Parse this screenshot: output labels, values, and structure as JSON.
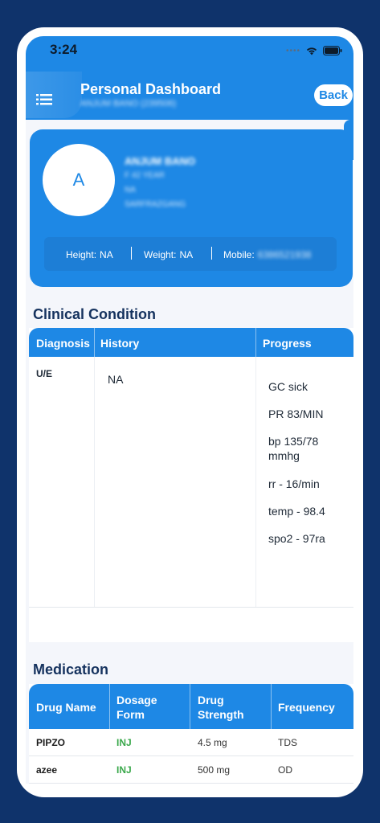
{
  "status": {
    "time": "3:24"
  },
  "header": {
    "title": "Personal Dashboard",
    "subtitle": "ANJUM BANO (239506)",
    "back_label": "Back"
  },
  "profile": {
    "avatar_letter": "A",
    "name": "ANJUM BANO",
    "line1": "F 42 YEAR",
    "line2": "NA",
    "line3": "SARFRAZGANG",
    "height_label": "Height:",
    "height_value": "NA",
    "weight_label": "Weight:",
    "weight_value": "NA",
    "mobile_label": "Mobile:",
    "mobile_value": "6386521938"
  },
  "clinical": {
    "title": "Clinical Condition",
    "headers": [
      "Diagnosis",
      "History",
      "Progress"
    ],
    "diagnosis": "U/E",
    "history": "NA",
    "progress": [
      "GC sick",
      "PR 83/MIN",
      "bp 135/78 mmhg",
      "rr - 16/min",
      "temp - 98.4",
      "spo2 - 97ra"
    ]
  },
  "medication": {
    "title": "Medication",
    "headers": [
      "Drug Name",
      "Dosage Form",
      "Drug Strength",
      "Frequency"
    ],
    "rows": [
      {
        "drug": "PIPZO",
        "form": "INJ",
        "strength": "4.5 mg",
        "frequency": "TDS"
      },
      {
        "drug": "azee",
        "form": "INJ",
        "strength": "500 mg",
        "frequency": "OD"
      }
    ]
  },
  "colors": {
    "primary": "#1e88e5",
    "background": "#0f336b",
    "accent_green": "#3aa84b"
  }
}
